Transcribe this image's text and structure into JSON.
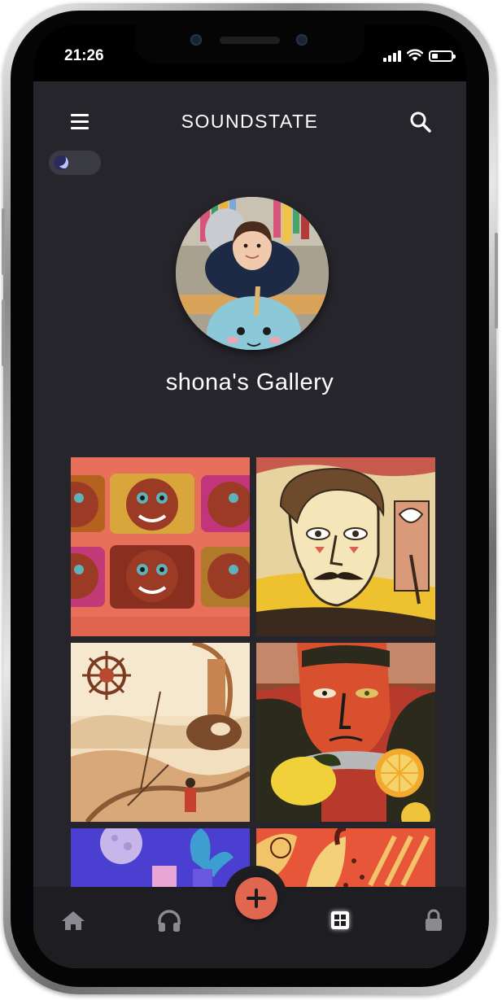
{
  "status_bar": {
    "time": "21:26",
    "signal_icon": "signal-icon",
    "wifi_icon": "wifi-icon",
    "battery_icon": "battery-icon"
  },
  "app_bar": {
    "menu_icon": "menu-icon",
    "brand": "SOUNDSTATE",
    "search_icon": "search-icon"
  },
  "theme_toggle": {
    "icon": "moon-icon",
    "dark_mode": true
  },
  "profile": {
    "avatar": "avatar-photo",
    "gallery_title": "shona's Gallery"
  },
  "gallery": {
    "tiles": [
      {
        "name": "clay-faces-artwork"
      },
      {
        "name": "mustache-portrait-artwork"
      },
      {
        "name": "surreal-desert-artwork"
      },
      {
        "name": "red-face-lemon-artwork"
      },
      {
        "name": "purple-moon-artwork"
      },
      {
        "name": "orange-figures-artwork"
      }
    ]
  },
  "bottom_nav": {
    "items": [
      {
        "icon": "home-icon"
      },
      {
        "icon": "headphones-icon"
      },
      {
        "icon": "plus-icon"
      },
      {
        "icon": "grid-icon",
        "active": true
      },
      {
        "icon": "lock-icon"
      }
    ]
  },
  "colors": {
    "background": "#25252b",
    "accent": "#e0664f",
    "nav_background": "#1e1e22"
  }
}
